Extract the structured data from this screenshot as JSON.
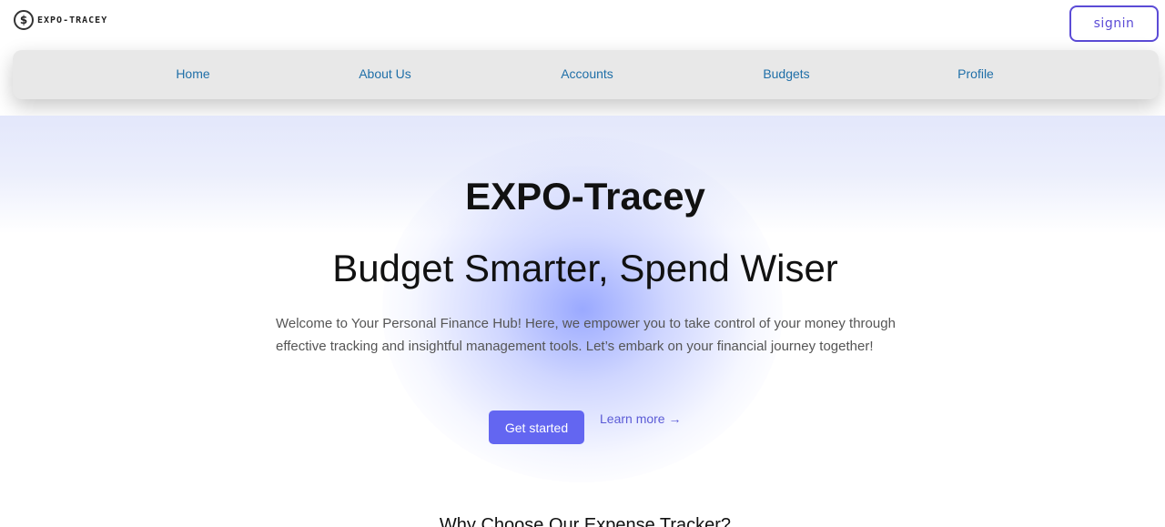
{
  "header": {
    "logo_text": "EXPO-TRACEY",
    "logo_icon": "dollar-coin-icon",
    "signin_label": "signin"
  },
  "nav": {
    "items": [
      {
        "label": "Home"
      },
      {
        "label": "About Us"
      },
      {
        "label": "Accounts"
      },
      {
        "label": "Budgets"
      },
      {
        "label": "Profile"
      }
    ]
  },
  "hero": {
    "title": "EXPO-Tracey",
    "subtitle": "Budget Smarter, Spend Wiser",
    "description": "Welcome to Your Personal Finance Hub! Here, we empower you to take control of your money through effective tracking and insightful management tools. Let’s embark on your financial journey together!",
    "primary_cta": "Get started",
    "secondary_cta": "Learn more →"
  },
  "features": {
    "heading": "Why Choose Our Expense Tracker?"
  },
  "colors": {
    "accent": "#6366f1",
    "nav_link": "#1f6fa8",
    "signin_border": "#5b4bd6"
  }
}
